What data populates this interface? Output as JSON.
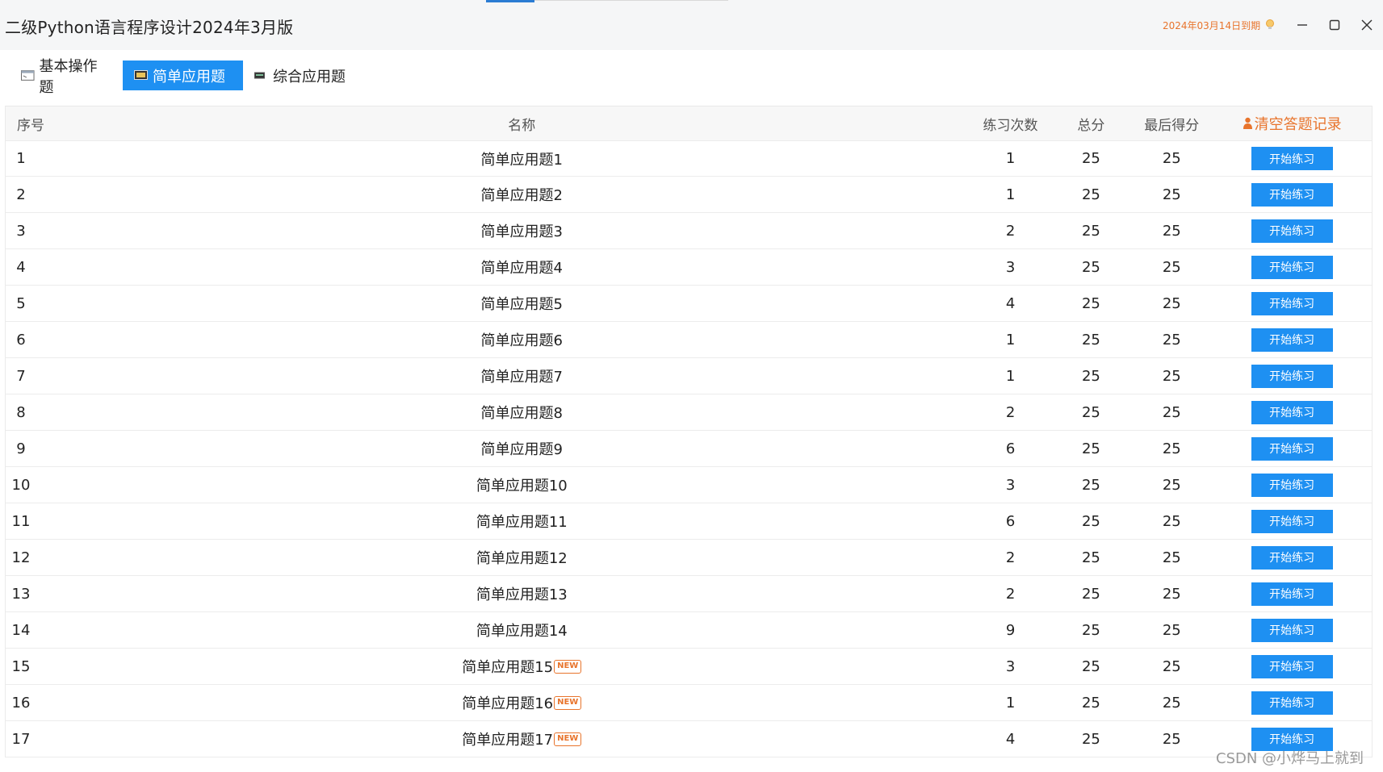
{
  "window": {
    "title": "二级Python语言程序设计2024年3月版",
    "expiry": "2024年03月14日到期",
    "icons": [
      "lightbulb-icon",
      "minimize-icon",
      "maximize-icon",
      "close-icon"
    ]
  },
  "tabs": [
    {
      "label": "基本操作题",
      "icon": "window-icon",
      "active": false
    },
    {
      "label": "简单应用题",
      "icon": "monitor-icon",
      "active": true
    },
    {
      "label": "综合应用题",
      "icon": "keyboard-icon",
      "active": false
    }
  ],
  "table": {
    "headers": {
      "index": "序号",
      "name": "名称",
      "count": "练习次数",
      "total": "总分",
      "last": "最后得分",
      "clear": "清空答题记录"
    },
    "action_label": "开始练习",
    "new_badge": "NEW",
    "rows": [
      {
        "index": "1",
        "name": "简单应用题1",
        "count": "1",
        "total": "25",
        "last": "25",
        "new": false
      },
      {
        "index": "2",
        "name": "简单应用题2",
        "count": "1",
        "total": "25",
        "last": "25",
        "new": false
      },
      {
        "index": "3",
        "name": "简单应用题3",
        "count": "2",
        "total": "25",
        "last": "25",
        "new": false
      },
      {
        "index": "4",
        "name": "简单应用题4",
        "count": "3",
        "total": "25",
        "last": "25",
        "new": false
      },
      {
        "index": "5",
        "name": "简单应用题5",
        "count": "4",
        "total": "25",
        "last": "25",
        "new": false
      },
      {
        "index": "6",
        "name": "简单应用题6",
        "count": "1",
        "total": "25",
        "last": "25",
        "new": false
      },
      {
        "index": "7",
        "name": "简单应用题7",
        "count": "1",
        "total": "25",
        "last": "25",
        "new": false
      },
      {
        "index": "8",
        "name": "简单应用题8",
        "count": "2",
        "total": "25",
        "last": "25",
        "new": false
      },
      {
        "index": "9",
        "name": "简单应用题9",
        "count": "6",
        "total": "25",
        "last": "25",
        "new": false
      },
      {
        "index": "10",
        "name": "简单应用题10",
        "count": "3",
        "total": "25",
        "last": "25",
        "new": false
      },
      {
        "index": "11",
        "name": "简单应用题11",
        "count": "6",
        "total": "25",
        "last": "25",
        "new": false
      },
      {
        "index": "12",
        "name": "简单应用题12",
        "count": "2",
        "total": "25",
        "last": "25",
        "new": false
      },
      {
        "index": "13",
        "name": "简单应用题13",
        "count": "2",
        "total": "25",
        "last": "25",
        "new": false
      },
      {
        "index": "14",
        "name": "简单应用题14",
        "count": "9",
        "total": "25",
        "last": "25",
        "new": false
      },
      {
        "index": "15",
        "name": "简单应用题15",
        "count": "3",
        "total": "25",
        "last": "25",
        "new": true
      },
      {
        "index": "16",
        "name": "简单应用题16",
        "count": "1",
        "total": "25",
        "last": "25",
        "new": true
      },
      {
        "index": "17",
        "name": "简单应用题17",
        "count": "4",
        "total": "25",
        "last": "25",
        "new": true
      }
    ]
  },
  "watermark": "CSDN @小烨马上就到",
  "colors": {
    "accent": "#1e90f2",
    "orange": "#e8742c",
    "titlebar": "#f5f6f7"
  }
}
